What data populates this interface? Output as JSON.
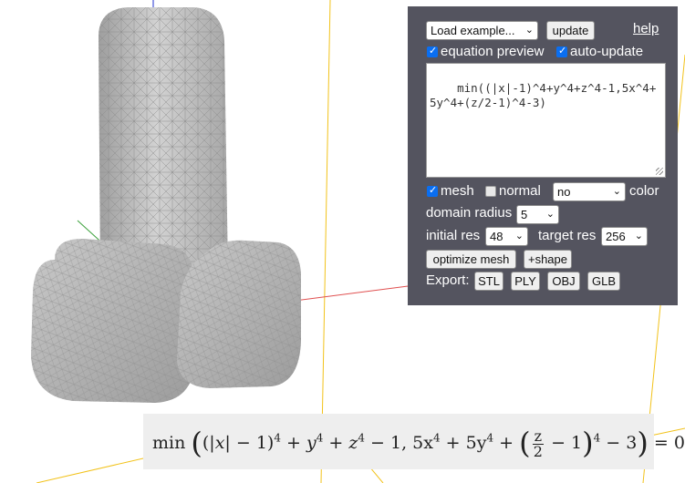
{
  "panel": {
    "load_example": "Load example...",
    "update_button": "update",
    "help_link": "help",
    "equation_preview_label": "equation preview",
    "equation_preview_checked": true,
    "auto_update_label": "auto-update",
    "auto_update_checked": true,
    "equation_text": "min((|x|-1)^4+y^4+z^4-1,5x^4+5y^4+(z/2-1)^4-3)",
    "mesh_label": "mesh",
    "mesh_checked": true,
    "normal_label": "normal",
    "normal_checked": false,
    "color_select": "no",
    "color_label": "color",
    "domain_radius_label": "domain radius",
    "domain_radius_value": "5",
    "initial_res_label": "initial res",
    "initial_res_value": "48",
    "target_res_label": "target res",
    "target_res_value": "256",
    "optimize_mesh_button": "optimize mesh",
    "add_shape_button": "+shape",
    "export_label": "Export:",
    "export_buttons": [
      "STL",
      "PLY",
      "OBJ",
      "GLB"
    ]
  },
  "formula": {
    "min": "min",
    "abs_x": "|x|",
    "minus_one_a": " − 1",
    "exp4": "4",
    "plus_y": " + y",
    "plus_z": " + z",
    "minus_one_comma": " − 1, 5x",
    "plus_5y": " + 5y",
    "plus": " + ",
    "frac_num": "z",
    "frac_den": "2",
    "minus_one_b": " − 1",
    "minus_3": " − 3",
    "equals_zero": " = 0"
  },
  "colors": {
    "panel_bg": "#54545f",
    "axis_x": "#e05050",
    "axis_y": "#3aa03a",
    "axis_z": "#2030d0",
    "grid_line": "#f2c21a",
    "mesh_fill": "#bcbcbc"
  }
}
